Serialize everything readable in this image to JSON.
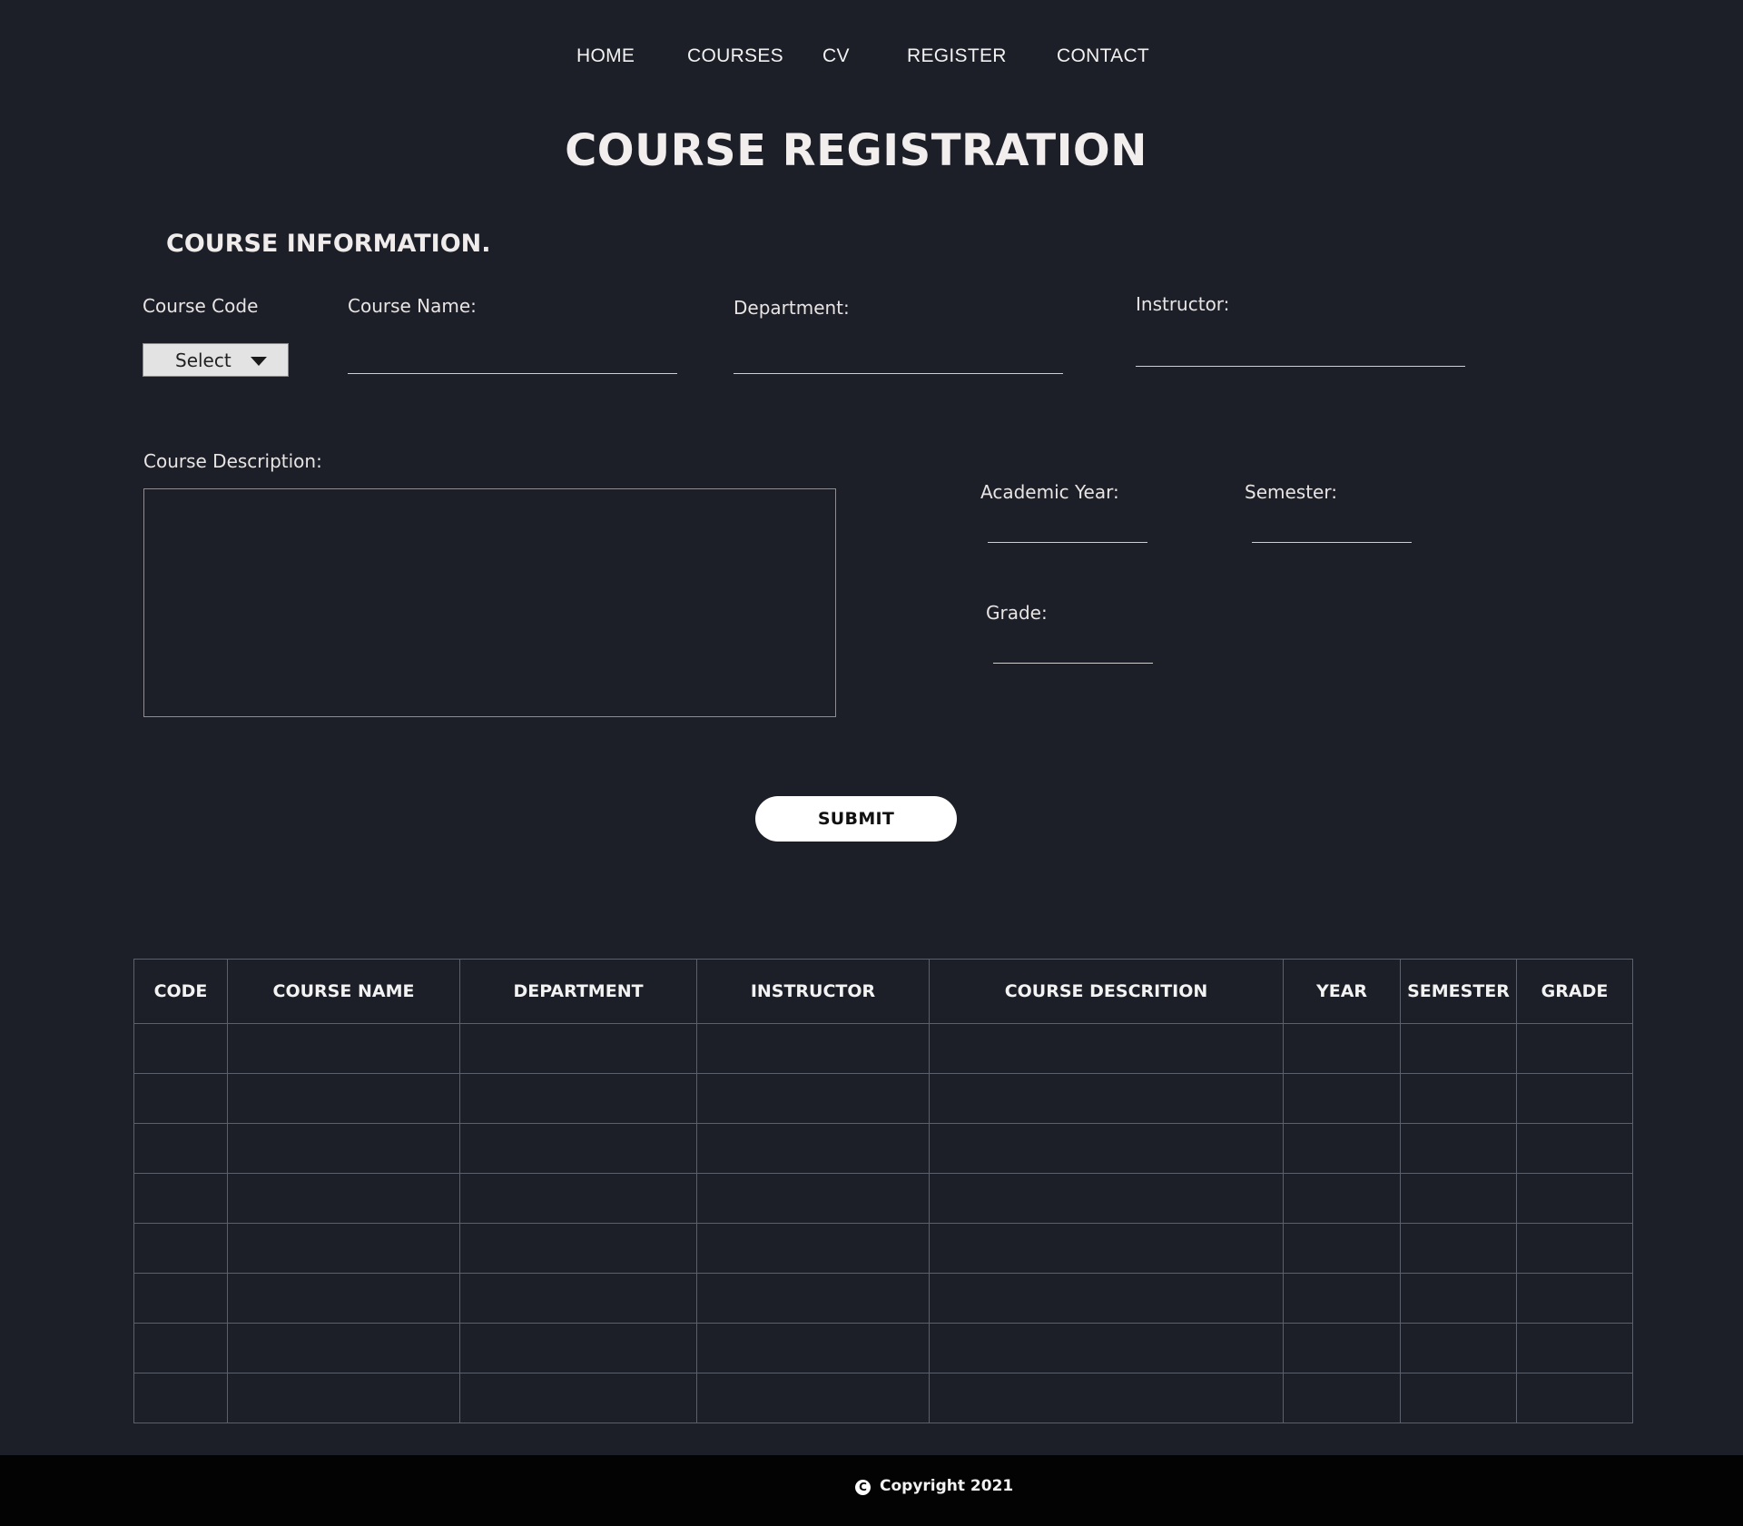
{
  "nav": {
    "items": [
      "HOME",
      "COURSES",
      "CV",
      "REGISTER",
      "CONTACT"
    ]
  },
  "page_title": "COURSE REGISTRATION",
  "section_title": "COURSE INFORMATION.",
  "form": {
    "course_code_label": "Course Code",
    "course_code_select": "Select",
    "course_name_label": "Course Name:",
    "department_label": "Department:",
    "instructor_label": "Instructor:",
    "description_label": "Course Description:",
    "academic_year_label": "Academic Year:",
    "semester_label": "Semester:",
    "grade_label": "Grade:",
    "submit_label": "SUBMIT"
  },
  "table": {
    "headers": [
      "CODE",
      "COURSE NAME",
      "DEPARTMENT",
      "INSTRUCTOR",
      "COURSE DESCRITION",
      "YEAR",
      "SEMESTER",
      "GRADE"
    ]
  },
  "footer": {
    "copyright_symbol": "C",
    "copyright_text": "Copyright 2021"
  },
  "colors": {
    "background": "#1c1f27",
    "footer": "#030303",
    "text": "#ece8e8",
    "submit_bg": "#ffffff"
  }
}
